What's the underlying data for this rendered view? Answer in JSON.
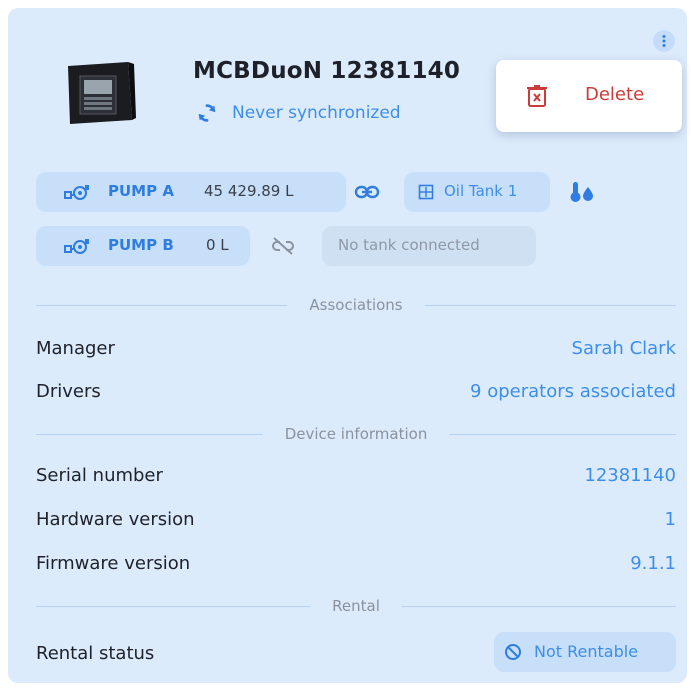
{
  "device": {
    "name": "MCBDuoN 12381140",
    "sync_status": "Never synchronized"
  },
  "menu": {
    "delete_label": "Delete"
  },
  "pumps": [
    {
      "name": "PUMP A",
      "volume": "45 429.89 L",
      "tank": "Oil Tank 1",
      "connected": true
    },
    {
      "name": "PUMP B",
      "volume": "0 L",
      "tank": "No tank connected",
      "connected": false
    }
  ],
  "sections": {
    "associations": "Associations",
    "device_info": "Device information",
    "rental": "Rental"
  },
  "associations": {
    "manager_label": "Manager",
    "manager_value": "Sarah Clark",
    "drivers_label": "Drivers",
    "drivers_value": "9 operators associated"
  },
  "device_info": {
    "serial_label": "Serial number",
    "serial_value": "12381140",
    "hardware_label": "Hardware version",
    "hardware_value": "1",
    "firmware_label": "Firmware version",
    "firmware_value": "9.1.1"
  },
  "rental": {
    "status_label": "Rental status",
    "status_value": "Not Rentable"
  },
  "colors": {
    "accent": "#3d8eea",
    "danger": "#cc3b3b",
    "card_bg": "#dcebfb"
  }
}
